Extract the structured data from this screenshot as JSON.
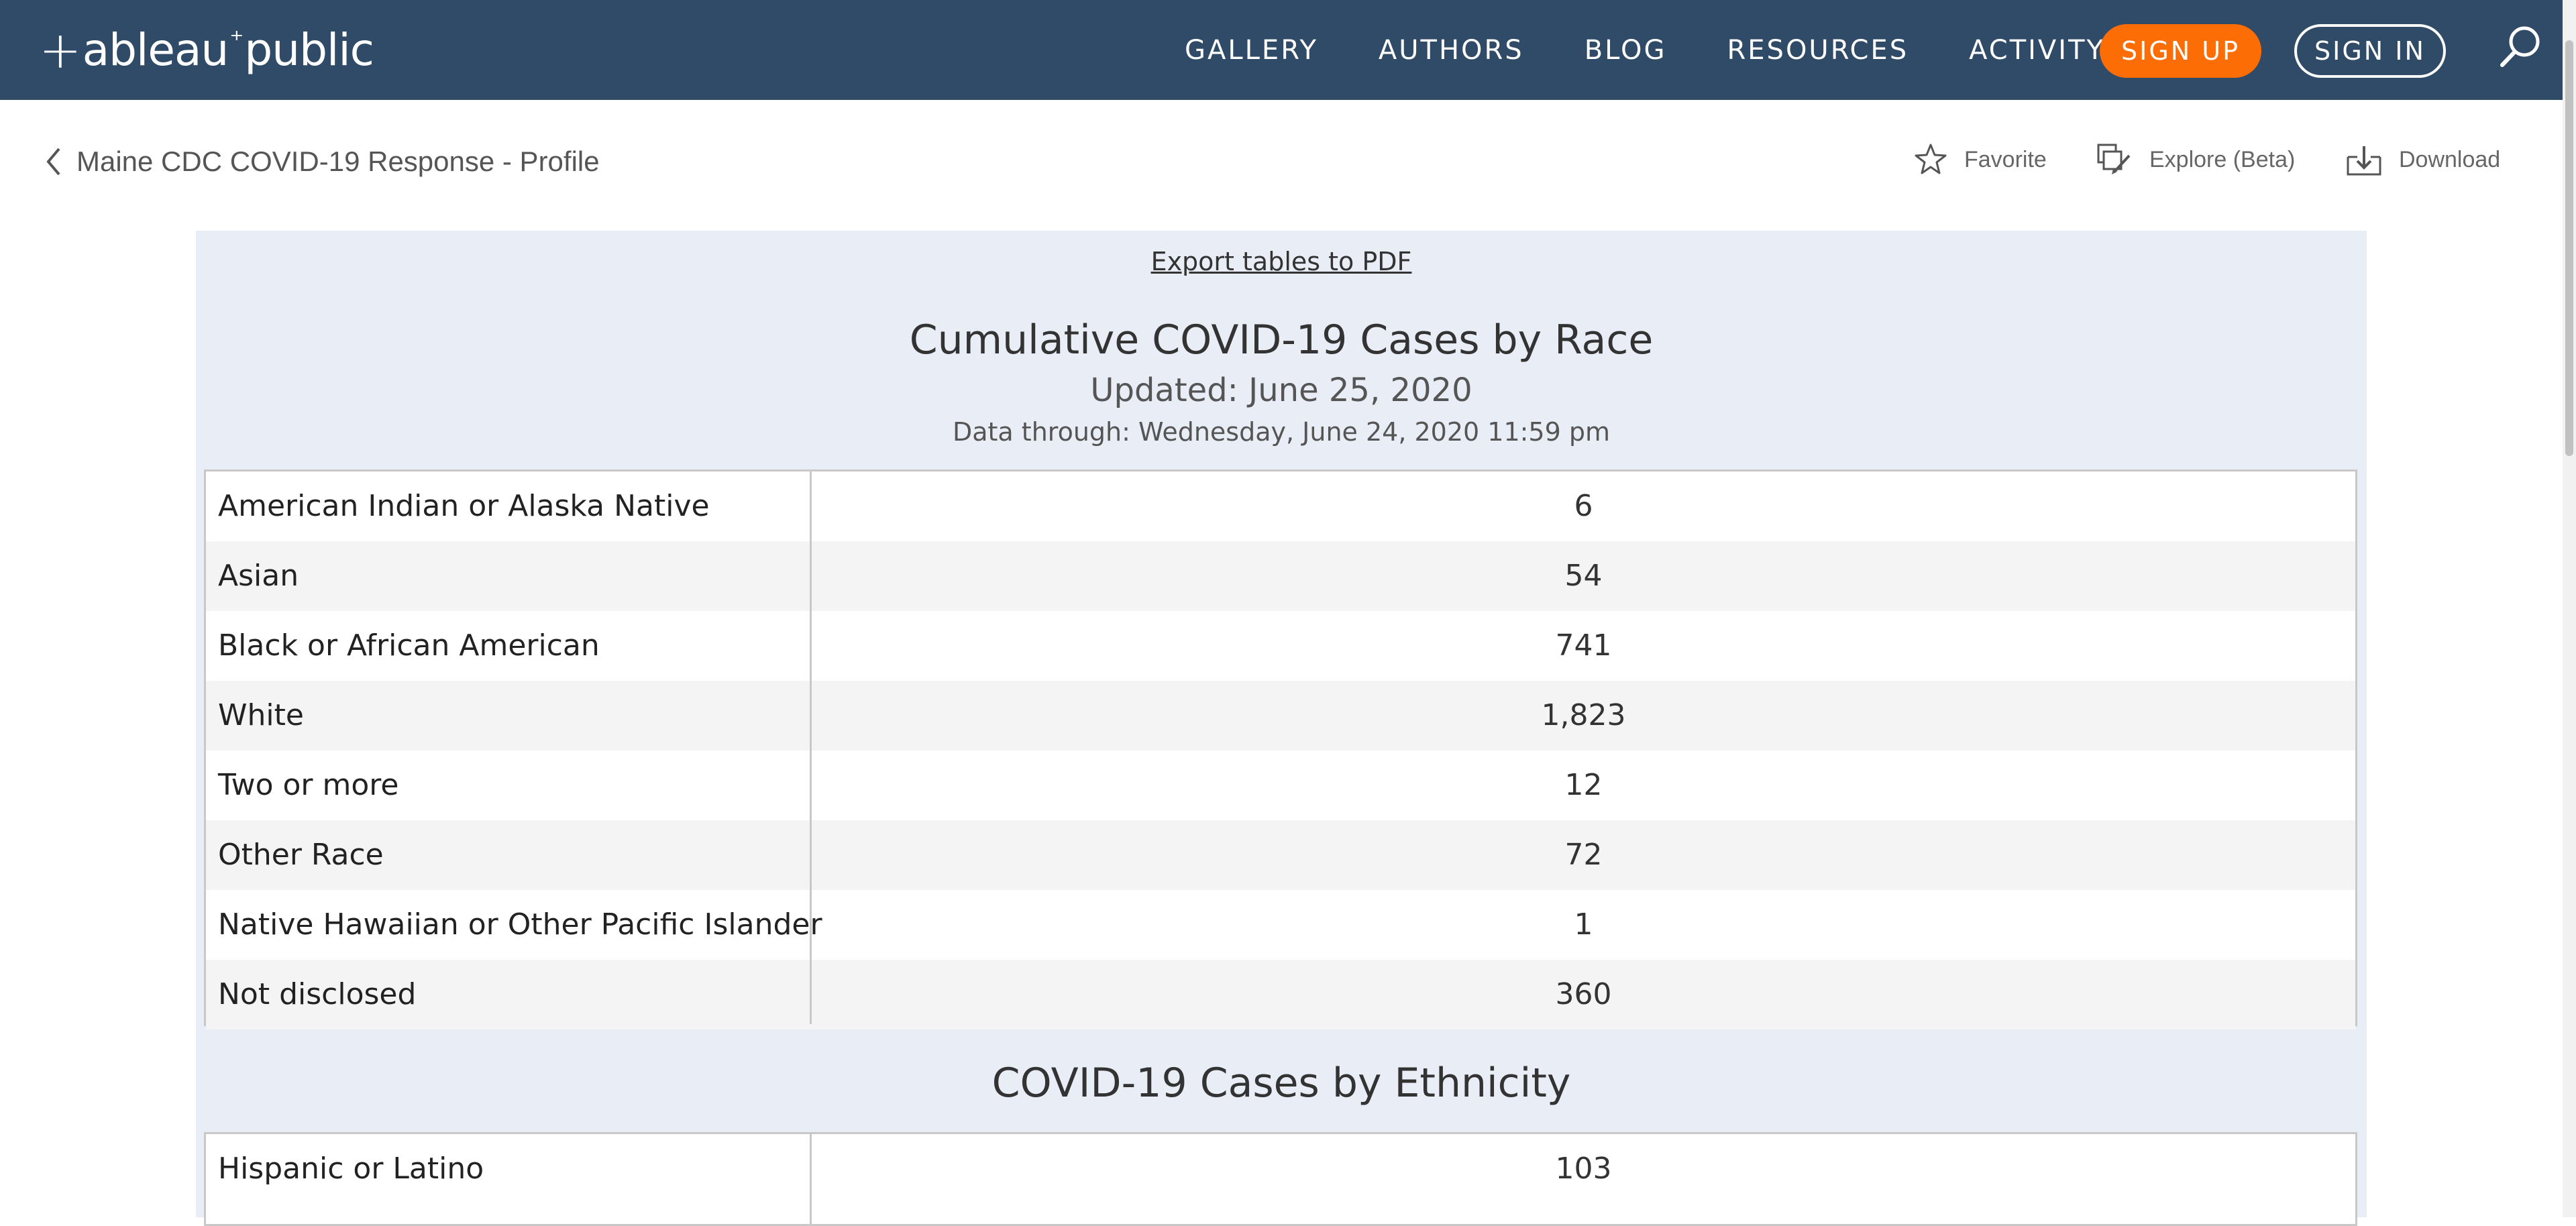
{
  "nav": {
    "logo_text": "+ableau+public",
    "logo": {
      "plus": "+",
      "left": "ableau",
      "sparkle": "⁺",
      "right": "public"
    },
    "links": [
      "GALLERY",
      "AUTHORS",
      "BLOG",
      "RESOURCES",
      "ACTIVITY"
    ],
    "signup_label": "SIGN UP",
    "signin_label": "SIGN IN",
    "search_icon": "search-icon"
  },
  "subheader": {
    "back_label": "Maine CDC COVID-19 Response - Profile",
    "actions": {
      "favorite": "Favorite",
      "explore": "Explore (Beta)",
      "download": "Download"
    }
  },
  "viz": {
    "export_link": "Export tables to PDF",
    "race": {
      "title": "Cumulative COVID-19 Cases by Race",
      "updated": "Updated: June 25, 2020",
      "data_through": "Data through: Wednesday, June 24, 2020 11:59 pm",
      "rows": [
        {
          "label": "American Indian or Alaska Native",
          "value": "6"
        },
        {
          "label": "Asian",
          "value": "54"
        },
        {
          "label": "Black or African American",
          "value": "741"
        },
        {
          "label": "White",
          "value": "1,823"
        },
        {
          "label": "Two or more",
          "value": "12"
        },
        {
          "label": "Other Race",
          "value": "72"
        },
        {
          "label": "Native Hawaiian or Other Pacific Islander",
          "value": "1"
        },
        {
          "label": "Not disclosed",
          "value": "360"
        }
      ]
    },
    "ethnicity": {
      "title": "COVID-19 Cases by Ethnicity",
      "rows": [
        {
          "label": "Hispanic or Latino",
          "value": "103"
        }
      ]
    }
  },
  "colors": {
    "nav_bg": "#2f4b67",
    "signup_bg": "#fc6d06",
    "viz_bg": "#e8edf6"
  }
}
